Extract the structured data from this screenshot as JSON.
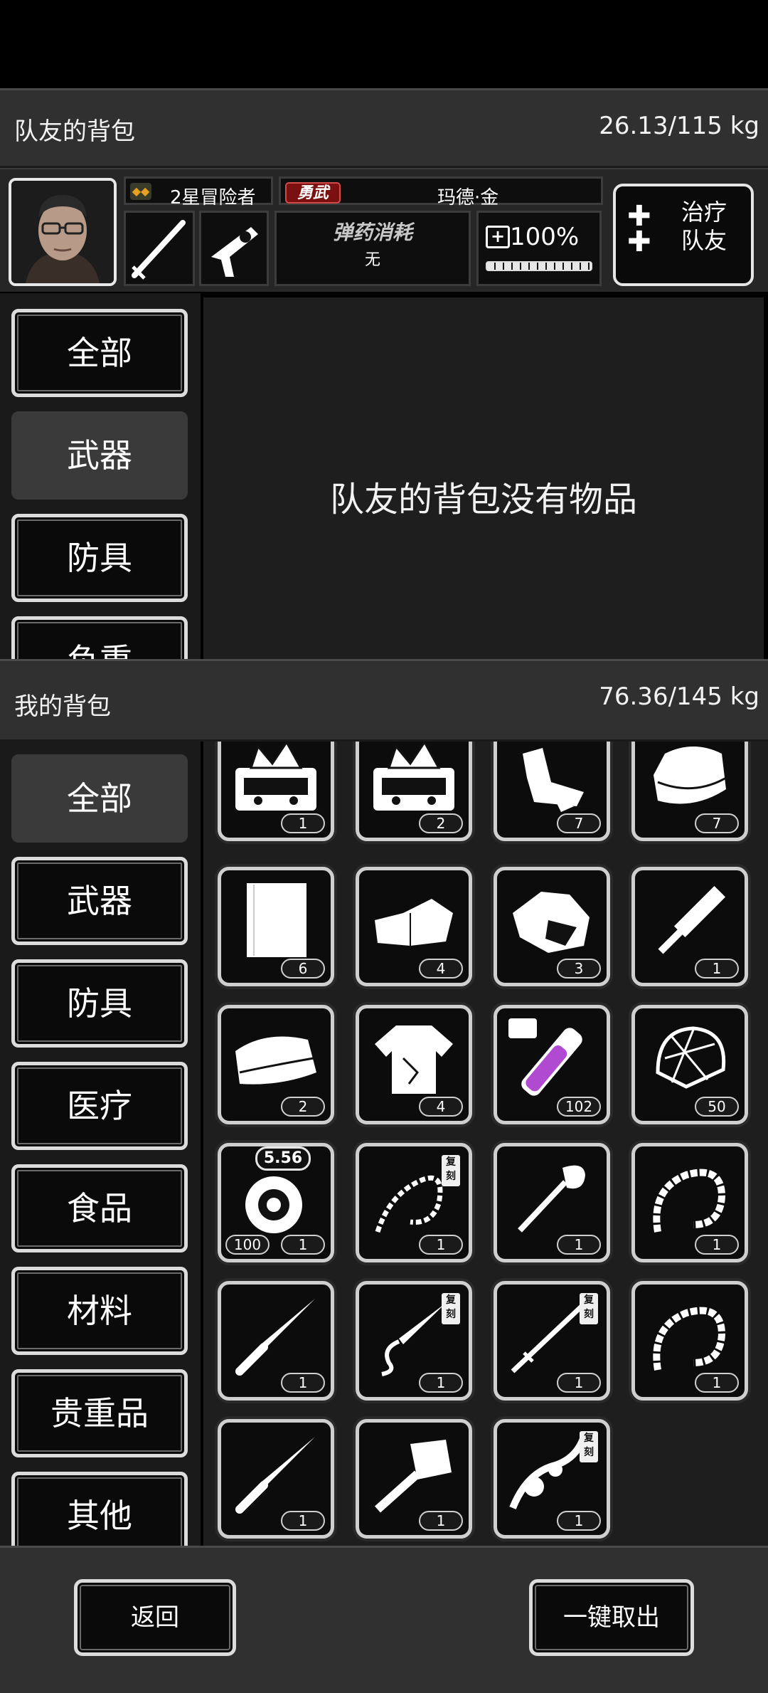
{
  "teammate_bag": {
    "title": "队友的背包",
    "weight": "26.13/115 kg",
    "empty_message": "队友的背包没有物品"
  },
  "teammate": {
    "rank": "2星冒险者",
    "trait": "勇武",
    "name": "玛德·金",
    "ammo_title": "弹药消耗",
    "ammo_value": "无",
    "health": "100%",
    "heal_button": [
      "治疗",
      "队友"
    ]
  },
  "teammate_tabs": [
    {
      "label": "全部",
      "active": false
    },
    {
      "label": "武器",
      "active": true
    },
    {
      "label": "防具",
      "active": false
    },
    {
      "label": "负重",
      "active": false
    }
  ],
  "my_bag": {
    "title": "我的背包",
    "weight": "76.36/145 kg"
  },
  "my_tabs": [
    {
      "label": "全部",
      "active": true
    },
    {
      "label": "武器",
      "active": false
    },
    {
      "label": "防具",
      "active": false
    },
    {
      "label": "医疗",
      "active": false
    },
    {
      "label": "食品",
      "active": false
    },
    {
      "label": "材料",
      "active": false
    },
    {
      "label": "贵重品",
      "active": false
    },
    {
      "label": "其他",
      "active": false
    }
  ],
  "items": [
    {
      "icon": "toolbox-icon",
      "qty": "1"
    },
    {
      "icon": "toolbox-icon",
      "qty": "2"
    },
    {
      "icon": "cloth-scraps-icon",
      "qty": "7"
    },
    {
      "icon": "folded-cloth-icon",
      "qty": "7"
    },
    {
      "icon": "paper-sheets-icon",
      "qty": "6"
    },
    {
      "icon": "bandage-icon",
      "qty": "4"
    },
    {
      "icon": "ore-chunk-icon",
      "qty": "3"
    },
    {
      "icon": "hammer-tool-icon",
      "qty": "1"
    },
    {
      "icon": "towel-icon",
      "qty": "2"
    },
    {
      "icon": "torn-shirt-icon",
      "qty": "4"
    },
    {
      "icon": "potion-vial-icon",
      "qty": "102"
    },
    {
      "icon": "net-icon",
      "qty": "50"
    },
    {
      "icon": "ammo-drum-icon",
      "qty": "1",
      "secondary_qty": "100",
      "badge": "5.56"
    },
    {
      "icon": "chain-whip-icon",
      "qty": "1",
      "copy": "复刻"
    },
    {
      "icon": "shovel-icon",
      "qty": "1"
    },
    {
      "icon": "bone-whip-icon",
      "qty": "1"
    },
    {
      "icon": "knife-icon",
      "qty": "1"
    },
    {
      "icon": "chain-blade-icon",
      "qty": "1",
      "copy": "复刻"
    },
    {
      "icon": "spear-icon",
      "qty": "1",
      "copy": "复刻"
    },
    {
      "icon": "bone-whip-icon",
      "qty": "1"
    },
    {
      "icon": "knife-icon",
      "qty": "1"
    },
    {
      "icon": "cleaver-icon",
      "qty": "1"
    },
    {
      "icon": "ornate-weapon-icon",
      "qty": "1",
      "copy": "复刻"
    }
  ],
  "buttons": {
    "back": "返回",
    "take_all": "一键取出"
  }
}
